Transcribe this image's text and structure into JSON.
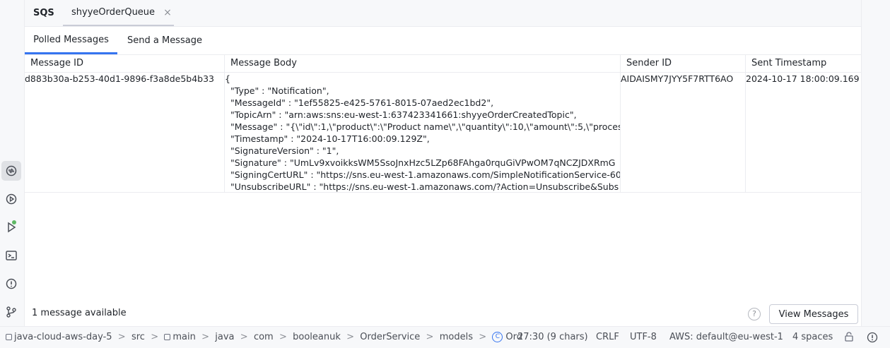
{
  "tool_window": {
    "title": "SQS",
    "queue_tab": "shyyeOrderQueue",
    "close_glyph": "×"
  },
  "sub_tabs": {
    "polled": "Polled Messages",
    "send": "Send a Message"
  },
  "table": {
    "columns": [
      "Message ID",
      "Message Body",
      "Sender ID",
      "Sent Timestamp"
    ],
    "rows": [
      {
        "message_id": "d883b30a-b253-40d1-9896-f3a8de5b4b33",
        "body_lines": [
          "{",
          "\"Type\" : \"Notification\",",
          "\"MessageId\" : \"1ef55825-e425-5761-8015-07aed2ec1bd2\",",
          "\"TopicArn\" : \"arn:aws:sns:eu-west-1:637423341661:shyyeOrderCreatedTopic\",",
          "\"Message\" : \"{\\\"id\\\":1,\\\"product\\\":\\\"Product name\\\",\\\"quantity\\\":10,\\\"amount\\\":5,\\\"process",
          "\"Timestamp\" : \"2024-10-17T16:00:09.129Z\",",
          "\"SignatureVersion\" : \"1\",",
          "\"Signature\" : \"UmLv9xvoikksWM5SsoJnxHzc5LZp68FAhga0rquGiVPwOM7qNCZJDXRmG",
          "\"SigningCertURL\" : \"https://sns.eu-west-1.amazonaws.com/SimpleNotificationService-60",
          "\"UnsubscribeURL\" : \"https://sns.eu-west-1.amazonaws.com/?Action=Unsubscribe&Subs"
        ],
        "sender_id": "AIDAISMY7JYY5F7RTT6AO",
        "sent_timestamp": "2024-10-17 18:00:09.169"
      }
    ]
  },
  "footer": {
    "count_text": "1 message available",
    "help_glyph": "?",
    "view_button": "View Messages"
  },
  "status_bar": {
    "breadcrumbs": [
      "java-cloud-aws-day-5",
      "src",
      "main",
      "java",
      "com",
      "booleanuk",
      "OrderService",
      "models",
      "Ord"
    ],
    "separator": ">",
    "position": "27:30 (9 chars)",
    "line_sep": "CRLF",
    "encoding": "UTF-8",
    "aws": "AWS: default@eu-west-1",
    "indent": "4 spaces",
    "class_glyph": "C"
  },
  "colors": {
    "accent": "#3574f0",
    "status_dot": "#5fb865"
  },
  "icons": [
    "services-icon",
    "run-debug-icon",
    "run-icon",
    "terminal-icon",
    "problems-icon",
    "git-icon",
    "lock-icon",
    "notifications-icon"
  ]
}
